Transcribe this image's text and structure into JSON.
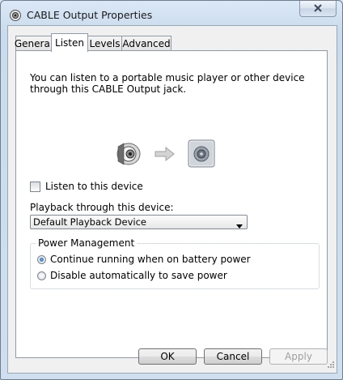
{
  "window": {
    "title": "CABLE Output Properties",
    "icon": "speaker-icon"
  },
  "tabs": [
    {
      "label": "General",
      "active": false
    },
    {
      "label": "Listen",
      "active": true
    },
    {
      "label": "Levels",
      "active": false
    },
    {
      "label": "Advanced",
      "active": false
    }
  ],
  "listen": {
    "description": "You can listen to a portable music player or other device through this CABLE Output jack.",
    "listen_checkbox_label": "Listen to this device",
    "listen_checked": false,
    "playback_label": "Playback through this device:",
    "playback_selected": "Default Playback Device",
    "power_group_label": "Power Management",
    "power_options": [
      {
        "label": "Continue running when on battery power",
        "selected": true
      },
      {
        "label": "Disable automatically to save power",
        "selected": false
      }
    ]
  },
  "buttons": {
    "ok": "OK",
    "cancel": "Cancel",
    "apply": "Apply",
    "apply_enabled": false
  },
  "colors": {
    "accent": "#1e5da6",
    "window_frame": "#c9dbee"
  }
}
